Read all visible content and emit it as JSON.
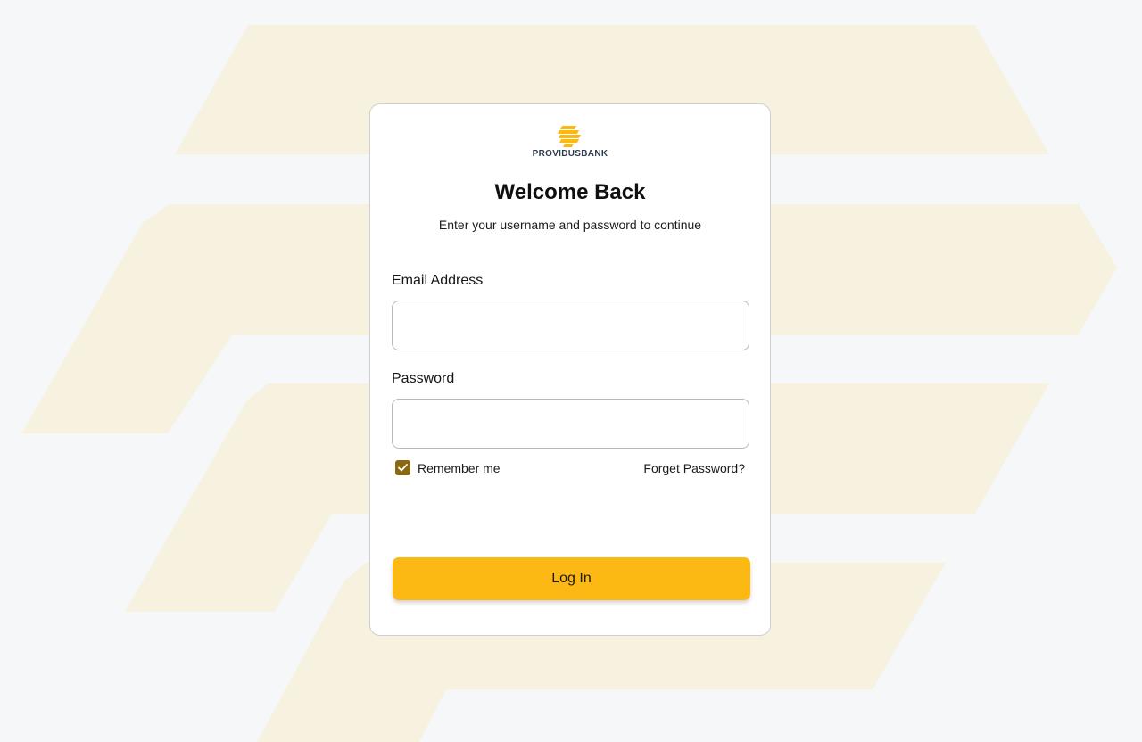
{
  "brand": {
    "name": "PROVIDUSBANK",
    "logo_icon": "providus-logo-icon",
    "accent_color": "#fdb913",
    "checkbox_color": "#8a6712",
    "background_shape_color": "#f7f1e0"
  },
  "heading": {
    "title": "Welcome Back",
    "subtitle": "Enter your username and password to continue"
  },
  "form": {
    "email": {
      "label": "Email Address",
      "value": "",
      "placeholder": ""
    },
    "password": {
      "label": "Password",
      "value": "",
      "placeholder": ""
    },
    "remember_me": {
      "label": "Remember me",
      "checked": true,
      "icon": "check-icon"
    },
    "forgot_password": "Forget Password?",
    "submit_label": "Log In"
  }
}
